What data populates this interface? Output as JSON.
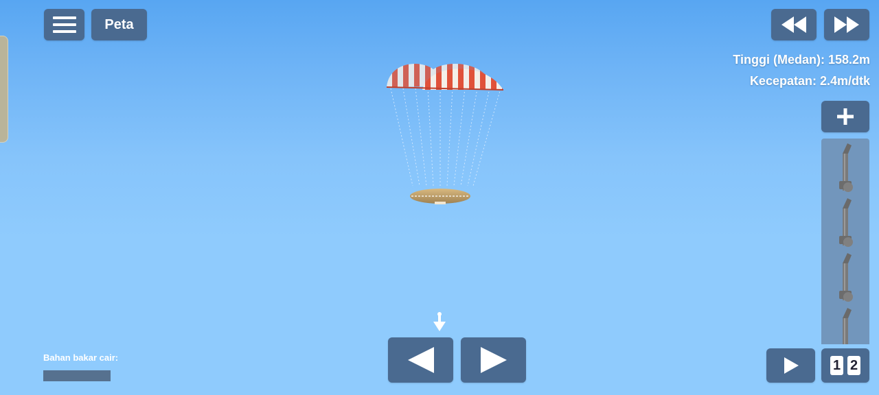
{
  "hud": {
    "map_label": "Peta",
    "altitude": "Tinggi (Medan): 158.2m",
    "speed": "Kecepatan: 2.4m/dtk"
  },
  "icons": {
    "menu": "hamburger-icon",
    "rewind": "rewind-icon",
    "fast_forward": "fast-forward-icon",
    "zoom": "plus-icon",
    "play": "play-icon",
    "left": "arrow-left-icon",
    "right": "arrow-right-icon",
    "marker": "down-arrow-marker-icon"
  },
  "fuel": {
    "label": "Bahan bakar cair:",
    "level": 0
  },
  "stage": {
    "digits": [
      "1",
      "2"
    ]
  },
  "colors": {
    "button": "#4a6a90",
    "sky_top": "#58a6f2",
    "sky_bottom": "#8fcbfd",
    "parachute_red": "#e0523a",
    "heatshield": "#c9a66b"
  }
}
